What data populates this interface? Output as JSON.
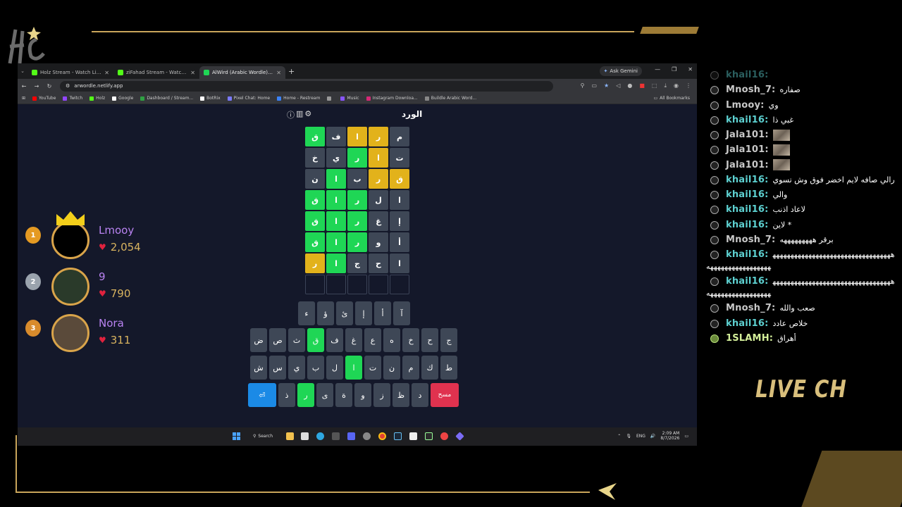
{
  "browser": {
    "tabs": [
      {
        "title": "Holz Stream - Watch Live on K",
        "color": "#53fc18",
        "active": false
      },
      {
        "title": "ziFahad Stream - Watch Live on",
        "color": "#53fc18",
        "active": false
      },
      {
        "title": "AlWird (Arabic Wordle) - الورد",
        "color": "#1fd655",
        "active": true
      }
    ],
    "ask_gemini": "Ask Gemini",
    "url": "arwordle.netlify.app",
    "bookmarks": [
      {
        "label": "YouTube",
        "color": "#ff0000"
      },
      {
        "label": "Twitch",
        "color": "#9146ff"
      },
      {
        "label": "Holz",
        "color": "#53fc18"
      },
      {
        "label": "Google",
        "color": "#ffffff"
      },
      {
        "label": "Dashboard / Stream...",
        "color": "#2ea043"
      },
      {
        "label": "BotRix",
        "color": "#ffffff"
      },
      {
        "label": "Pixel Chat: Home",
        "color": "#7a7aff"
      },
      {
        "label": "Home - Restream",
        "color": "#3b82f6"
      },
      {
        "label": "",
        "color": "#999999"
      },
      {
        "label": "Music",
        "color": "#8855ff"
      },
      {
        "label": "Instagram Downloa...",
        "color": "#d62976"
      },
      {
        "label": "Buildle Arabic Word...",
        "color": "#888888"
      }
    ],
    "all_bookmarks": "All Bookmarks"
  },
  "game": {
    "title": "الورد",
    "grid": [
      [
        {
          "l": "م",
          "s": "a"
        },
        {
          "l": "ر",
          "s": "p"
        },
        {
          "l": "ا",
          "s": "p"
        },
        {
          "l": "ف",
          "s": "a"
        },
        {
          "l": "ق",
          "s": "c"
        }
      ],
      [
        {
          "l": "ت",
          "s": "a"
        },
        {
          "l": "ا",
          "s": "p"
        },
        {
          "l": "ر",
          "s": "c"
        },
        {
          "l": "ي",
          "s": "a"
        },
        {
          "l": "خ",
          "s": "a"
        }
      ],
      [
        {
          "l": "ق",
          "s": "p"
        },
        {
          "l": "ر",
          "s": "p"
        },
        {
          "l": "ب",
          "s": "a"
        },
        {
          "l": "ا",
          "s": "c"
        },
        {
          "l": "ن",
          "s": "a"
        }
      ],
      [
        {
          "l": "ا",
          "s": "a"
        },
        {
          "l": "ل",
          "s": "a"
        },
        {
          "l": "ر",
          "s": "c"
        },
        {
          "l": "ا",
          "s": "c"
        },
        {
          "l": "ق",
          "s": "c"
        }
      ],
      [
        {
          "l": "إ",
          "s": "a"
        },
        {
          "l": "غ",
          "s": "a"
        },
        {
          "l": "ر",
          "s": "c"
        },
        {
          "l": "ا",
          "s": "c"
        },
        {
          "l": "ق",
          "s": "c"
        }
      ],
      [
        {
          "l": "أ",
          "s": "a"
        },
        {
          "l": "و",
          "s": "a"
        },
        {
          "l": "ر",
          "s": "c"
        },
        {
          "l": "ا",
          "s": "c"
        },
        {
          "l": "ق",
          "s": "c"
        }
      ],
      [
        {
          "l": "ا",
          "s": "a"
        },
        {
          "l": "ح",
          "s": "a"
        },
        {
          "l": "ج",
          "s": "a"
        },
        {
          "l": "ا",
          "s": "c"
        },
        {
          "l": "ر",
          "s": "p"
        }
      ],
      [
        {
          "l": "",
          "s": "e"
        },
        {
          "l": "",
          "s": "e"
        },
        {
          "l": "",
          "s": "e"
        },
        {
          "l": "",
          "s": "e"
        },
        {
          "l": "",
          "s": "e"
        }
      ]
    ],
    "keyboard": [
      [
        {
          "l": "آ",
          "s": "a"
        },
        {
          "l": "أ",
          "s": "a"
        },
        {
          "l": "إ",
          "s": "a"
        },
        {
          "l": "ئ",
          "s": "a"
        },
        {
          "l": "ؤ",
          "s": "a"
        },
        {
          "l": "ء",
          "s": "a"
        }
      ],
      [
        {
          "l": "ج",
          "s": "a"
        },
        {
          "l": "ح",
          "s": "a"
        },
        {
          "l": "خ",
          "s": "a"
        },
        {
          "l": "ه",
          "s": "a"
        },
        {
          "l": "ع",
          "s": "a"
        },
        {
          "l": "غ",
          "s": "a"
        },
        {
          "l": "ف",
          "s": "a"
        },
        {
          "l": "ق",
          "s": "c"
        },
        {
          "l": "ث",
          "s": "a"
        },
        {
          "l": "ص",
          "s": "a"
        },
        {
          "l": "ض",
          "s": "a"
        }
      ],
      [
        {
          "l": "ط",
          "s": "a"
        },
        {
          "l": "ك",
          "s": "a"
        },
        {
          "l": "م",
          "s": "a"
        },
        {
          "l": "ن",
          "s": "a"
        },
        {
          "l": "ت",
          "s": "a"
        },
        {
          "l": "ا",
          "s": "c"
        },
        {
          "l": "ل",
          "s": "a"
        },
        {
          "l": "ب",
          "s": "a"
        },
        {
          "l": "ي",
          "s": "a"
        },
        {
          "l": "س",
          "s": "a"
        },
        {
          "l": "ش",
          "s": "a"
        }
      ],
      [
        {
          "l": "مسح",
          "s": "del"
        },
        {
          "l": "د",
          "s": "a"
        },
        {
          "l": "ظ",
          "s": "a"
        },
        {
          "l": "ز",
          "s": "a"
        },
        {
          "l": "و",
          "s": "a"
        },
        {
          "l": "ة",
          "s": "a"
        },
        {
          "l": "ى",
          "s": "a"
        },
        {
          "l": "ر",
          "s": "c"
        },
        {
          "l": "ذ",
          "s": "a"
        },
        {
          "l": "⏎",
          "s": "enter"
        }
      ]
    ]
  },
  "taskbar": {
    "search": "Search",
    "lang": "ENG",
    "time": "2:09 AM",
    "date": "8/7/2026"
  },
  "leaderboard": [
    {
      "rank": "1",
      "name": "Lmooy",
      "score": "2,054",
      "rank_color": "#e59a22",
      "avatar_bg": "#000000"
    },
    {
      "rank": "2",
      "name": "9",
      "score": "790",
      "rank_color": "#9aa3ad",
      "avatar_bg": "#2a3a2a"
    },
    {
      "rank": "3",
      "name": "Nora",
      "score": "311",
      "rank_color": "#d88b2c",
      "avatar_bg": "#5a4a3a"
    }
  ],
  "chat": [
    {
      "user": "khail16:",
      "color": "#5dd0d0",
      "text": "",
      "partial": true
    },
    {
      "user": "Mnosh_7:",
      "color": "#c8c8c8",
      "text": "صفاره"
    },
    {
      "user": "Lmooy:",
      "color": "#c8c8c8",
      "text": "وي"
    },
    {
      "user": "khail16:",
      "color": "#5dd0d0",
      "text": "غبي ذا"
    },
    {
      "user": "Jala101:",
      "color": "#c8c8c8",
      "text": "",
      "emote": true
    },
    {
      "user": "Jala101:",
      "color": "#c8c8c8",
      "text": "",
      "emote": true
    },
    {
      "user": "Jala101:",
      "color": "#c8c8c8",
      "text": "",
      "emote": true
    },
    {
      "user": "khail16:",
      "color": "#5dd0d0",
      "text": "رالي صافه لايم اخضر فوق وش تسوي",
      "wrap": true
    },
    {
      "user": "khail16:",
      "color": "#5dd0d0",
      "text": "والي"
    },
    {
      "user": "khail16:",
      "color": "#5dd0d0",
      "text": "لاعاد اذنب"
    },
    {
      "user": "khail16:",
      "color": "#5dd0d0",
      "text": "لاين *"
    },
    {
      "user": "Mnosh_7:",
      "color": "#c8c8c8",
      "text": "برقر هههههههههه"
    },
    {
      "user": "khail16:",
      "color": "#5dd0d0",
      "text": "هههههههههههههههههههههههههههههههههههههههههههههههههههه",
      "wrap": true
    },
    {
      "user": "khail16:",
      "color": "#5dd0d0",
      "text": "هههههههههههههههههههههههههههههههههههههههههههههههههههه",
      "wrap": true
    },
    {
      "user": "Mnosh_7:",
      "color": "#c8c8c8",
      "text": "صعب والله"
    },
    {
      "user": "khail16:",
      "color": "#5dd0d0",
      "text": "خلاص عادد"
    },
    {
      "user": "1SLAMH:",
      "color": "#d4ef9a",
      "text": "أهراق",
      "badge": true
    }
  ],
  "overlay": {
    "live_chat": "LIVE CH",
    "accent": "#c9a55a"
  }
}
